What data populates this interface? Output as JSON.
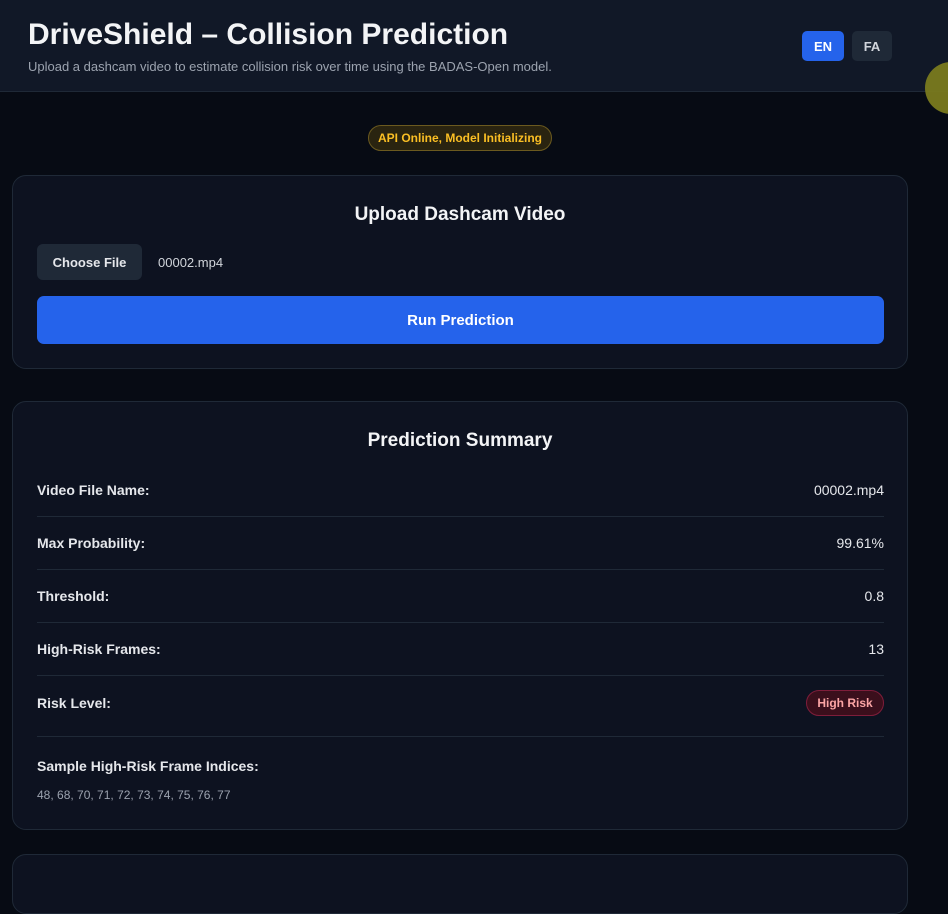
{
  "header": {
    "title": "DriveShield – Collision Prediction",
    "subtitle": "Upload a dashcam video to estimate collision risk over time using the BADAS-Open model.",
    "languages": [
      "EN",
      "FA"
    ],
    "active_language": "EN"
  },
  "status": {
    "text": "API Online, Model Initializing",
    "color": "#fbbf24"
  },
  "upload": {
    "title": "Upload Dashcam Video",
    "choose_file_label": "Choose File",
    "file_name": "00002.mp4",
    "run_label": "Run Prediction"
  },
  "summary": {
    "title": "Prediction Summary",
    "rows": [
      {
        "label": "Video File Name:",
        "value": "00002.mp4"
      },
      {
        "label": "Max Probability:",
        "value": "99.61%"
      },
      {
        "label": "Threshold:",
        "value": "0.8"
      },
      {
        "label": "High-Risk Frames:",
        "value": "13"
      }
    ],
    "risk_level_label": "Risk Level:",
    "risk_level_value": "High Risk",
    "indices_label": "Sample High-Risk Frame Indices:",
    "indices_value": "48, 68, 70, 71, 72, 73, 74, 75, 76, 77"
  },
  "colors": {
    "accent": "#2563eb",
    "background": "#070b14",
    "card": "#0d1220",
    "danger": "#fca5a5"
  }
}
